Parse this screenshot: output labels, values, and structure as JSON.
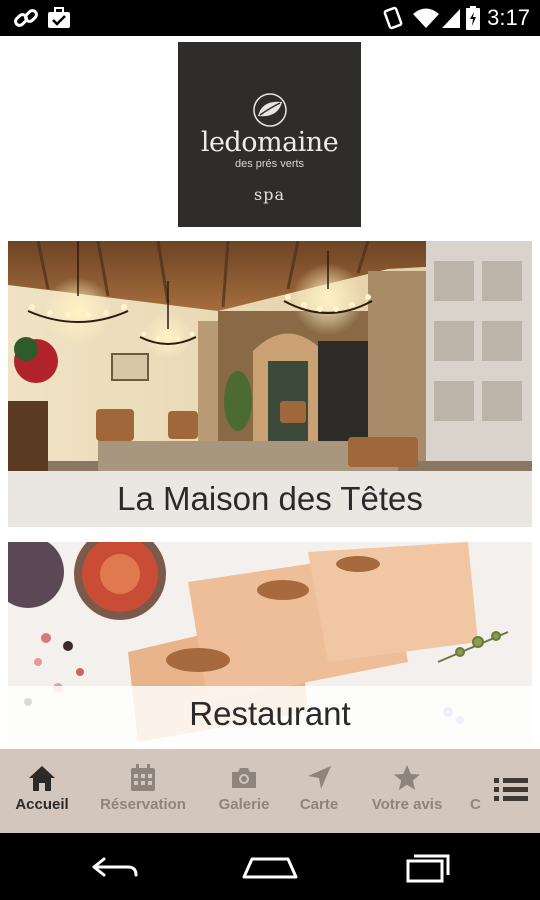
{
  "status_bar": {
    "time": "3:17",
    "icons": [
      "link-icon",
      "briefcase-icon",
      "vibrate-icon",
      "wifi-icon",
      "signal-icon",
      "battery-icon"
    ]
  },
  "logo": {
    "brand": "ledomaine",
    "subtitle": "des prés verts",
    "spa": "spa"
  },
  "cards": [
    {
      "title": "La Maison des Têtes"
    },
    {
      "title": "Restaurant"
    }
  ],
  "tabs": [
    {
      "label": "Accueil",
      "icon": "home-icon",
      "active": true
    },
    {
      "label": "Réservation",
      "icon": "calendar-icon",
      "active": false
    },
    {
      "label": "Galerie",
      "icon": "camera-icon",
      "active": false
    },
    {
      "label": "Carte",
      "icon": "location-arrow-icon",
      "active": false
    },
    {
      "label": "Votre avis",
      "icon": "star-icon",
      "active": false
    },
    {
      "label": "C",
      "icon": "",
      "active": false
    }
  ],
  "more_icon": "list-icon",
  "nav": [
    "back-icon",
    "home-icon",
    "recents-icon"
  ],
  "colors": {
    "tabbar_bg": "#d3c7bd",
    "tab_active": "#2d2926",
    "tab_inactive": "#8f847b",
    "logo_bg": "#2f2d2c"
  }
}
